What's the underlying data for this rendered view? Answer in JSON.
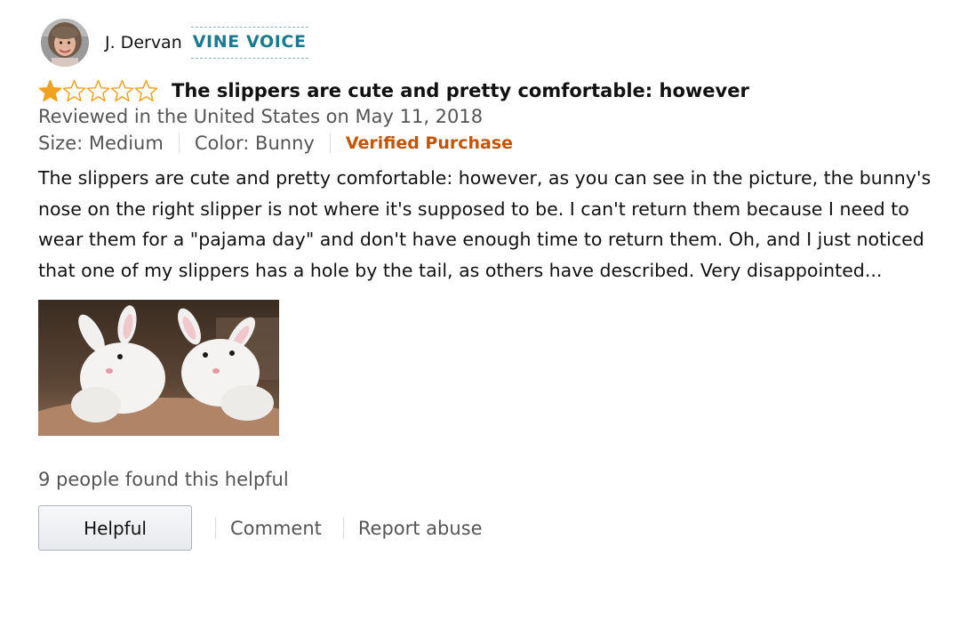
{
  "reviewer": {
    "name": "J. Dervan",
    "badge": "VINE VOICE",
    "avatar_icon": "user-avatar-photo"
  },
  "review": {
    "rating": 1,
    "max_rating": 5,
    "star_color": "#f0a11f",
    "title": "The slippers are cute and pretty comfortable: however",
    "date_line": "Reviewed in the United States on May 11, 2018",
    "size": "Size: Medium",
    "color": "Color: Bunny",
    "verified": "Verified Purchase",
    "body": "The slippers are cute and pretty comfortable: however, as you can see in the picture, the bunny's nose on the right slipper is not where it's supposed to be. I can't return them because I need to wear them for a \"pajama day\" and don't have enough time to return them. Oh, and I just noticed that one of my slippers has a hole by the tail, as others have described. Very disappointed...",
    "image_alt": "bunny-slippers-photo"
  },
  "helpful_count": "9 people found this helpful",
  "actions": {
    "helpful": "Helpful",
    "comment": "Comment",
    "report": "Report abuse"
  },
  "colors": {
    "vine": "#197a90",
    "verified": "#c45500",
    "secondary_text": "#555555"
  }
}
